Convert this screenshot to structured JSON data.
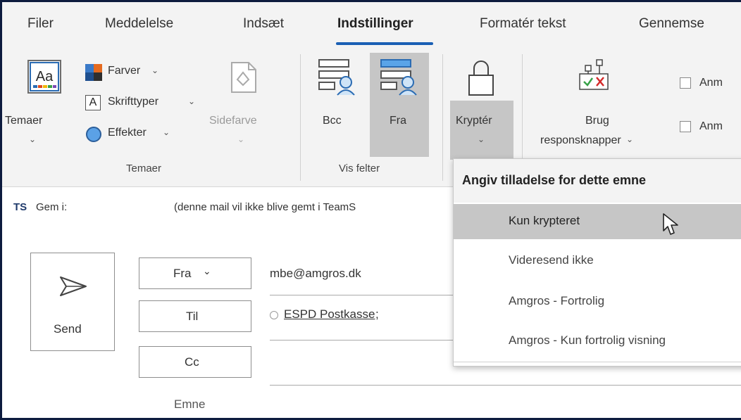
{
  "tabs": [
    "Filer",
    "Meddelelse",
    "Indsæt",
    "Indstillinger",
    "Formatér tekst",
    "Gennemse"
  ],
  "active_tab": "Indstillinger",
  "ribbon": {
    "temaer_button": "Temaer",
    "farver": "Farver",
    "skrifttyper": "Skrifttyper",
    "effekter": "Effekter",
    "sidefarve": "Sidefarve",
    "bcc": "Bcc",
    "fra": "Fra",
    "krypter": "Kryptér",
    "brug_line1": "Brug",
    "brug_line2": "responsknapper",
    "anm1": "Anm",
    "anm2": "Anm",
    "group_temaer": "Temaer",
    "group_vis_felter": "Vis felter",
    "theme_icon_text": "Aa"
  },
  "savebar": {
    "ts_icon": "TS",
    "gem_label": "Gem i:",
    "gem_value": "(denne mail vil ikke blive gemt i TeamS"
  },
  "compose": {
    "send": "Send",
    "fra_button": "Fra",
    "fra_value": "mbe@amgros.dk",
    "til_button": "Til",
    "til_recipient": "ESPD Postkasse",
    "til_separator": ";",
    "cc_button": "Cc",
    "emne": "Emne"
  },
  "dropdown": {
    "title": "Angiv tilladelse for dette emne",
    "items": [
      "Kun krypteret",
      "Videresend ikke",
      "Amgros - Fortrolig",
      "Amgros - Kun fortrolig visning"
    ],
    "hovered_index": 0
  },
  "colors": {
    "accent": "#1a5fb4",
    "ribbon_bg": "#f3f3f3",
    "selected_bg": "#c6c6c6",
    "frame_border": "#0d1b3e"
  }
}
